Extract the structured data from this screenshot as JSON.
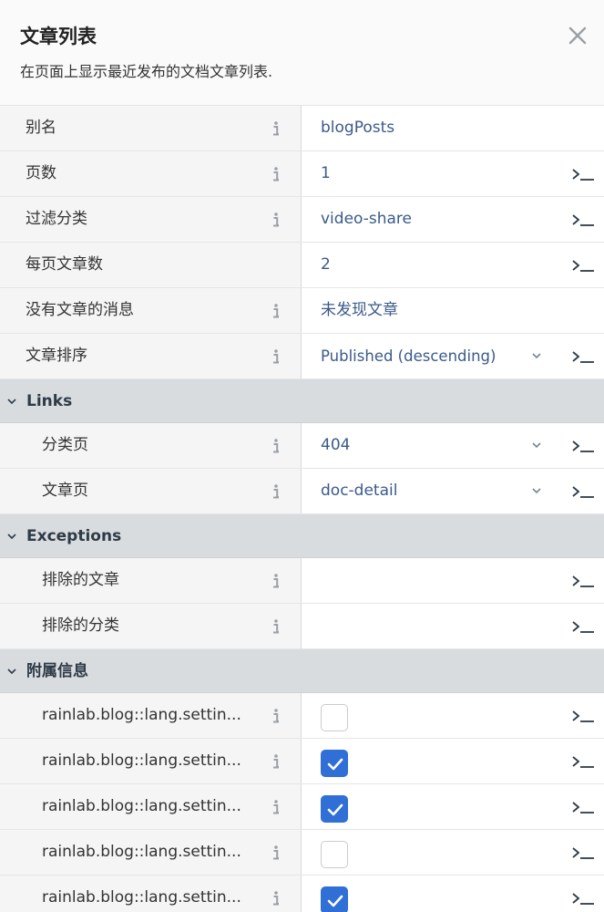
{
  "header": {
    "title": "文章列表",
    "description": "在页面上显示最近发布的文档文章列表."
  },
  "properties": [
    {
      "label": "别名",
      "value": "blogPosts",
      "info": true,
      "dropdown": false,
      "terminal": false
    },
    {
      "label": "页数",
      "value": "1",
      "info": true,
      "dropdown": false,
      "terminal": true
    },
    {
      "label": "过滤分类",
      "value": "video-share",
      "info": true,
      "dropdown": false,
      "terminal": true
    },
    {
      "label": "每页文章数",
      "value": "2",
      "info": false,
      "dropdown": false,
      "terminal": true
    },
    {
      "label": "没有文章的消息",
      "value": "未发现文章",
      "info": true,
      "dropdown": false,
      "terminal": false
    },
    {
      "label": "文章排序",
      "value": "Published (descending)",
      "info": true,
      "dropdown": true,
      "terminal": true
    }
  ],
  "groups": {
    "links": {
      "title": "Links",
      "items": [
        {
          "label": "分类页",
          "value": "404"
        },
        {
          "label": "文章页",
          "value": "doc-detail"
        }
      ]
    },
    "exceptions": {
      "title": "Exceptions",
      "items": [
        {
          "label": "排除的文章",
          "value": ""
        },
        {
          "label": "排除的分类",
          "value": ""
        }
      ]
    },
    "attached": {
      "title": "附属信息",
      "items": [
        {
          "label": "rainlab.blog::lang.settin...",
          "checked": false
        },
        {
          "label": "rainlab.blog::lang.settin...",
          "checked": true
        },
        {
          "label": "rainlab.blog::lang.settin...",
          "checked": true
        },
        {
          "label": "rainlab.blog::lang.settin...",
          "checked": false
        },
        {
          "label": "rainlab.blog::lang.settin...",
          "checked": true
        }
      ]
    }
  },
  "icons": {
    "close": "close-icon",
    "info": "info-icon",
    "terminal": "terminal-icon",
    "chevron": "chevron-down-icon",
    "check": "check-icon"
  },
  "colors": {
    "checkbox_checked": "#2f6fd6",
    "value_text": "#3a5a8a",
    "group_bg": "#d9dcdf",
    "label_bg": "#f5f5f5"
  }
}
